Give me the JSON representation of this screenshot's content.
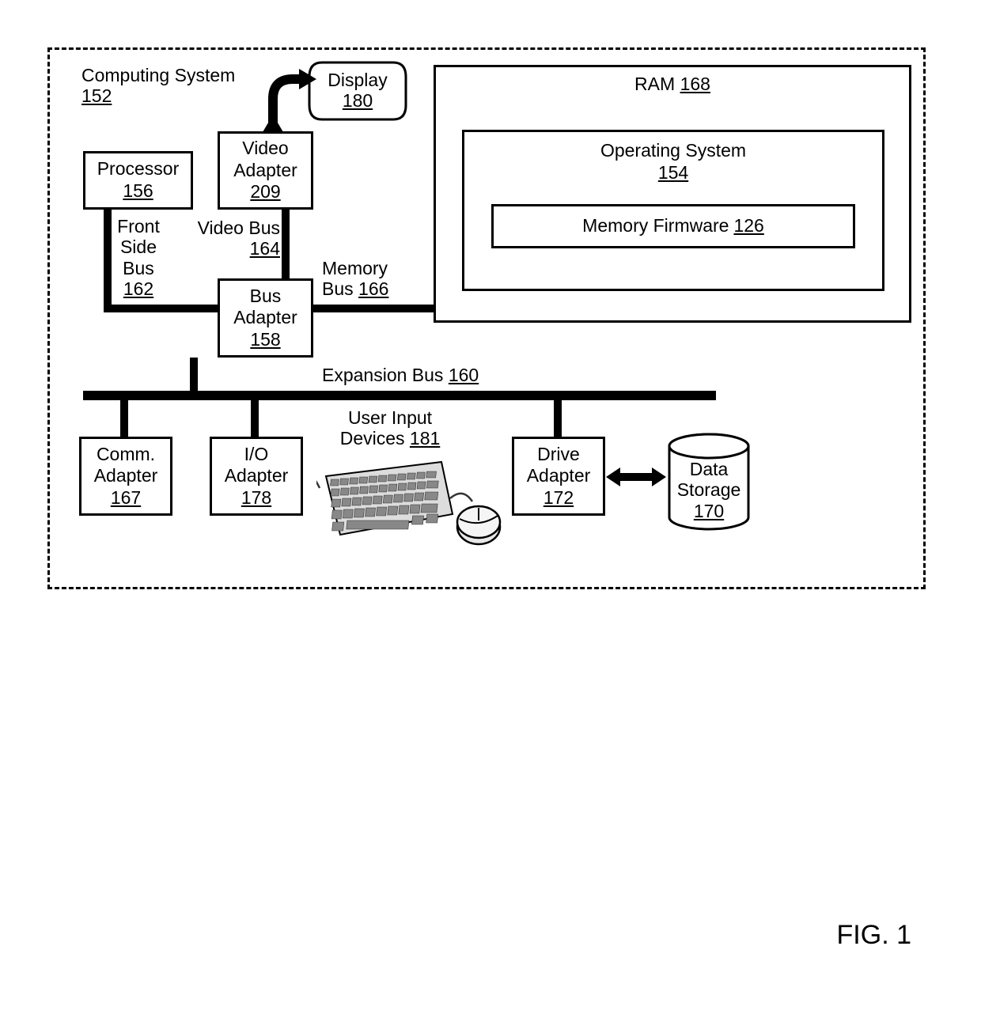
{
  "figureLabel": "FIG. 1",
  "computingSystem": {
    "label": "Computing System",
    "ref": "152"
  },
  "display": {
    "label": "Display",
    "ref": "180"
  },
  "processor": {
    "label": "Processor",
    "ref": "156"
  },
  "videoAdapter": {
    "label": "Video",
    "label2": "Adapter",
    "ref": "209"
  },
  "frontSideBus": {
    "l1": "Front",
    "l2": "Side",
    "l3": "Bus",
    "ref": "162"
  },
  "videoBus": {
    "label": "Video Bus",
    "ref": "164"
  },
  "busAdapter": {
    "l1": "Bus",
    "l2": "Adapter",
    "ref": "158"
  },
  "memoryBus": {
    "label": "Memory",
    "label2": "Bus",
    "ref": "166"
  },
  "ram": {
    "label": "RAM",
    "ref": "168"
  },
  "os": {
    "label": "Operating System",
    "ref": "154"
  },
  "memFirmware": {
    "label": "Memory Firmware",
    "ref": "126"
  },
  "expansionBus": {
    "label": "Expansion Bus",
    "ref": "160"
  },
  "commAdapter": {
    "l1": "Comm.",
    "l2": "Adapter",
    "ref": "167"
  },
  "ioAdapter": {
    "l1": "I/O",
    "l2": "Adapter",
    "ref": "178"
  },
  "userInput": {
    "l1": "User Input",
    "l2": "Devices",
    "ref": "181"
  },
  "driveAdapter": {
    "l1": "Drive",
    "l2": "Adapter",
    "ref": "172"
  },
  "dataStorage": {
    "l1": "Data",
    "l2": "Storage",
    "ref": "170"
  }
}
